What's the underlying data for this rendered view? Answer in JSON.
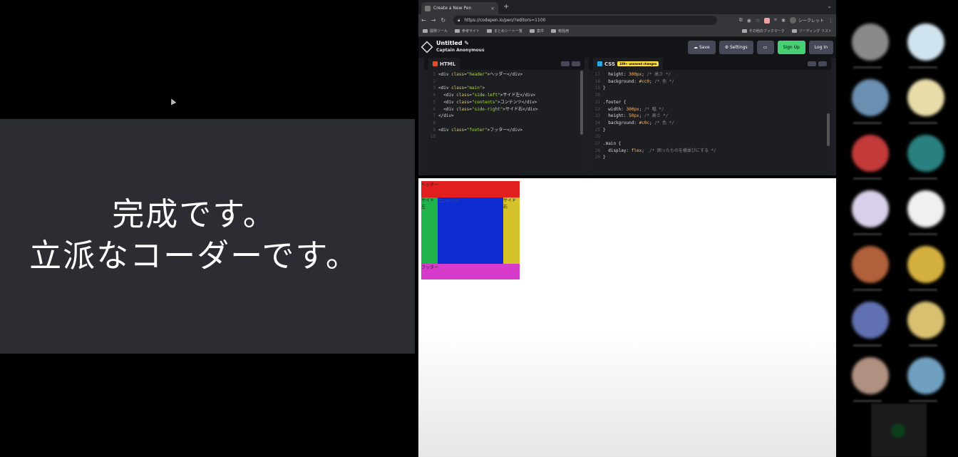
{
  "slide": {
    "line1": "完成です。",
    "line2": "立派なコーダーです。"
  },
  "browser": {
    "tab_title": "Create a New Pen",
    "tab_close": "×",
    "new_tab": "+",
    "tab_menu": "⌄",
    "url": "https://codepen.io/pen/?editors=1100",
    "profile_label": "シークレット",
    "bookmarks": [
      "開発ツール",
      "参考サイト",
      "まとめシート一覧",
      "案件",
      "勉強用"
    ],
    "bookmarks_right": [
      "その他のブックマーク",
      "リーディング リスト"
    ]
  },
  "codepen": {
    "title": "Untitled ✎",
    "author": "Captain Anonymous",
    "save": "☁ Save",
    "settings": "⚙ Settings",
    "signup": "Sign Up",
    "login": "Log In"
  },
  "html_editor": {
    "label": "HTML",
    "lines": [
      {
        "n": "1",
        "parts": [
          [
            "tag",
            "<div "
          ],
          [
            "attr",
            "class"
          ],
          [
            "tag",
            "="
          ],
          [
            "str",
            "\"header\""
          ],
          [
            "tag",
            ">"
          ],
          [
            "sel",
            "ヘッダー"
          ],
          [
            "tag",
            "</div>"
          ]
        ]
      },
      {
        "n": "2",
        "parts": []
      },
      {
        "n": "3",
        "parts": [
          [
            "tag",
            "<div "
          ],
          [
            "attr",
            "class"
          ],
          [
            "tag",
            "="
          ],
          [
            "str",
            "\"main\""
          ],
          [
            "tag",
            ">"
          ]
        ]
      },
      {
        "n": "4",
        "parts": [
          [
            "tag",
            "  <div "
          ],
          [
            "attr",
            "class"
          ],
          [
            "tag",
            "="
          ],
          [
            "str",
            "\"side-left\""
          ],
          [
            "tag",
            ">"
          ],
          [
            "sel",
            "サイド左"
          ],
          [
            "tag",
            "</div>"
          ]
        ]
      },
      {
        "n": "5",
        "parts": [
          [
            "tag",
            "  <div "
          ],
          [
            "attr",
            "class"
          ],
          [
            "tag",
            "="
          ],
          [
            "str",
            "\"contents\""
          ],
          [
            "tag",
            ">"
          ],
          [
            "sel",
            "コンテンツ"
          ],
          [
            "tag",
            "</div>"
          ]
        ]
      },
      {
        "n": "6",
        "parts": [
          [
            "tag",
            "  <div "
          ],
          [
            "attr",
            "class"
          ],
          [
            "tag",
            "="
          ],
          [
            "str",
            "\"side-right\""
          ],
          [
            "tag",
            ">"
          ],
          [
            "sel",
            "サイド右"
          ],
          [
            "tag",
            "</div>"
          ]
        ]
      },
      {
        "n": "7",
        "parts": [
          [
            "tag",
            "</div>"
          ]
        ]
      },
      {
        "n": "8",
        "parts": []
      },
      {
        "n": "9",
        "parts": [
          [
            "tag",
            "<div "
          ],
          [
            "attr",
            "class"
          ],
          [
            "tag",
            "="
          ],
          [
            "str",
            "\"footer\""
          ],
          [
            "tag",
            ">"
          ],
          [
            "sel",
            "フッター"
          ],
          [
            "tag",
            "</div>"
          ]
        ]
      },
      {
        "n": "10",
        "parts": []
      }
    ]
  },
  "css_editor": {
    "label": "CSS",
    "badge": "100+ unsaved changes",
    "lines": [
      {
        "n": "17",
        "parts": [
          [
            "prop",
            "  height: "
          ],
          [
            "num",
            "300px"
          ],
          [
            "prop",
            "; "
          ],
          [
            "cmt",
            "/* 高さ */"
          ]
        ]
      },
      {
        "n": "18",
        "parts": [
          [
            "prop",
            "  background: "
          ],
          [
            "num",
            "#cc0"
          ],
          [
            "prop",
            "; "
          ],
          [
            "cmt",
            "/* 色 */"
          ]
        ]
      },
      {
        "n": "19",
        "parts": [
          [
            "sel",
            "}"
          ]
        ]
      },
      {
        "n": "20",
        "parts": []
      },
      {
        "n": "21",
        "parts": [
          [
            "sel",
            ".footer {"
          ]
        ]
      },
      {
        "n": "22",
        "parts": [
          [
            "prop",
            "  width: "
          ],
          [
            "num",
            "300px"
          ],
          [
            "prop",
            "; "
          ],
          [
            "cmt",
            "/* 幅 */"
          ]
        ]
      },
      {
        "n": "23",
        "parts": [
          [
            "prop",
            "  height: "
          ],
          [
            "num",
            "50px"
          ],
          [
            "prop",
            "; "
          ],
          [
            "cmt",
            "/* 高さ */"
          ]
        ]
      },
      {
        "n": "24",
        "parts": [
          [
            "prop",
            "  background: "
          ],
          [
            "num",
            "#c0c"
          ],
          [
            "prop",
            "; "
          ],
          [
            "cmt",
            "/* 色 */"
          ]
        ]
      },
      {
        "n": "25",
        "parts": [
          [
            "sel",
            "}"
          ]
        ]
      },
      {
        "n": "26",
        "parts": []
      },
      {
        "n": "27",
        "parts": [
          [
            "sel",
            ".main {"
          ]
        ]
      },
      {
        "n": "28",
        "parts": [
          [
            "prop",
            "  display: "
          ],
          [
            "num",
            "flex"
          ],
          [
            "prop",
            ";  "
          ],
          [
            "cmt",
            "/* 囲ったものを横並びにする */"
          ]
        ]
      },
      {
        "n": "29",
        "parts": [
          [
            "sel",
            "}"
          ]
        ]
      }
    ]
  },
  "preview": {
    "header": "ヘッダー",
    "side_left": "サイド左",
    "contents": "コンテンツ",
    "side_right": "サイド右",
    "footer": "フッター"
  },
  "participants": {
    "colors": [
      "#8a8a8a",
      "#d0e4f0",
      "#6a8fb0",
      "#e8dca8",
      "#c23a3a",
      "#2a8080",
      "#d8d0e8",
      "#f0f0f0",
      "#b0603a",
      "#d4b040",
      "#6070b0",
      "#d8c070",
      "#b09080",
      "#70a0c0"
    ]
  }
}
